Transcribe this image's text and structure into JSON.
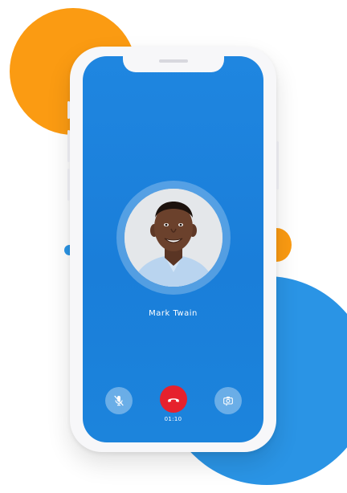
{
  "call": {
    "caller_name": "Mark Twain",
    "duration": "01:10"
  },
  "icons": {
    "mute": "microphone-off-icon",
    "end": "end-call-icon",
    "camera": "switch-camera-icon"
  },
  "colors": {
    "screen_blue": "#1f86e0",
    "accent_orange": "#fb9b12",
    "accent_blue": "#2a94e5",
    "end_call_red": "#e6212d"
  }
}
